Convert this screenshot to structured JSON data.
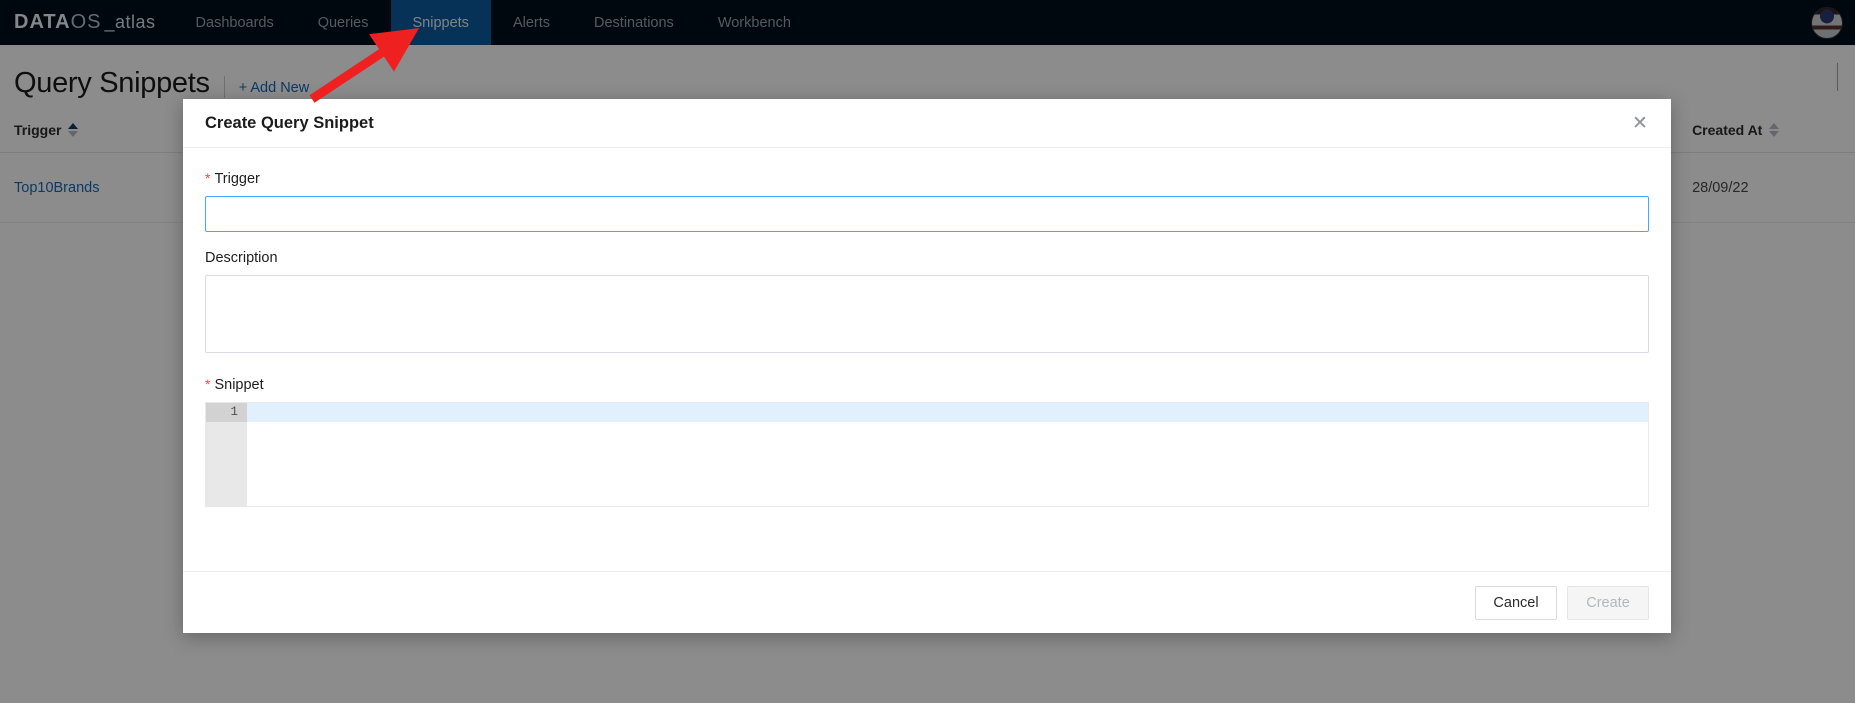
{
  "topbar": {
    "logo": {
      "data": "DATA",
      "os": "OS",
      "suffix": "_atlas"
    },
    "nav_items": [
      {
        "label": "Dashboards",
        "active": false
      },
      {
        "label": "Queries",
        "active": false
      },
      {
        "label": "Snippets",
        "active": true
      },
      {
        "label": "Alerts",
        "active": false
      },
      {
        "label": "Destinations",
        "active": false
      },
      {
        "label": "Workbench",
        "active": false
      }
    ],
    "active_tab": "Snippets",
    "active_tab_color": "#0b5c9e",
    "background_color": "#00101c"
  },
  "page": {
    "title": "Query Snippets",
    "add_new_label": "+ Add New",
    "add_new_color": "#1668b8"
  },
  "table": {
    "columns": [
      {
        "label": "Trigger",
        "sort": "asc"
      },
      {
        "label": "Created At",
        "sort": "none"
      }
    ],
    "rows": [
      {
        "trigger": "Top10Brands",
        "created_at": "28/09/22"
      }
    ]
  },
  "modal": {
    "title": "Create Query Snippet",
    "close_icon": "close-icon",
    "fields": {
      "trigger": {
        "label": "Trigger",
        "required": true,
        "value": "",
        "placeholder": "",
        "focused": true,
        "focus_color": "#40a9ff"
      },
      "description": {
        "label": "Description",
        "required": false,
        "value": "",
        "placeholder": ""
      },
      "snippet": {
        "label": "Snippet",
        "required": true,
        "value": "",
        "line_numbers": [
          "1"
        ],
        "active_line_color": "#e2effc",
        "gutter_color": "#e8e8e8"
      }
    },
    "buttons": {
      "cancel": {
        "label": "Cancel",
        "disabled": false
      },
      "create": {
        "label": "Create",
        "disabled": true
      }
    },
    "required_marker_color": "#f04848"
  },
  "annotation": {
    "arrow_color": "#ee2020",
    "points_to": "Snippets"
  }
}
